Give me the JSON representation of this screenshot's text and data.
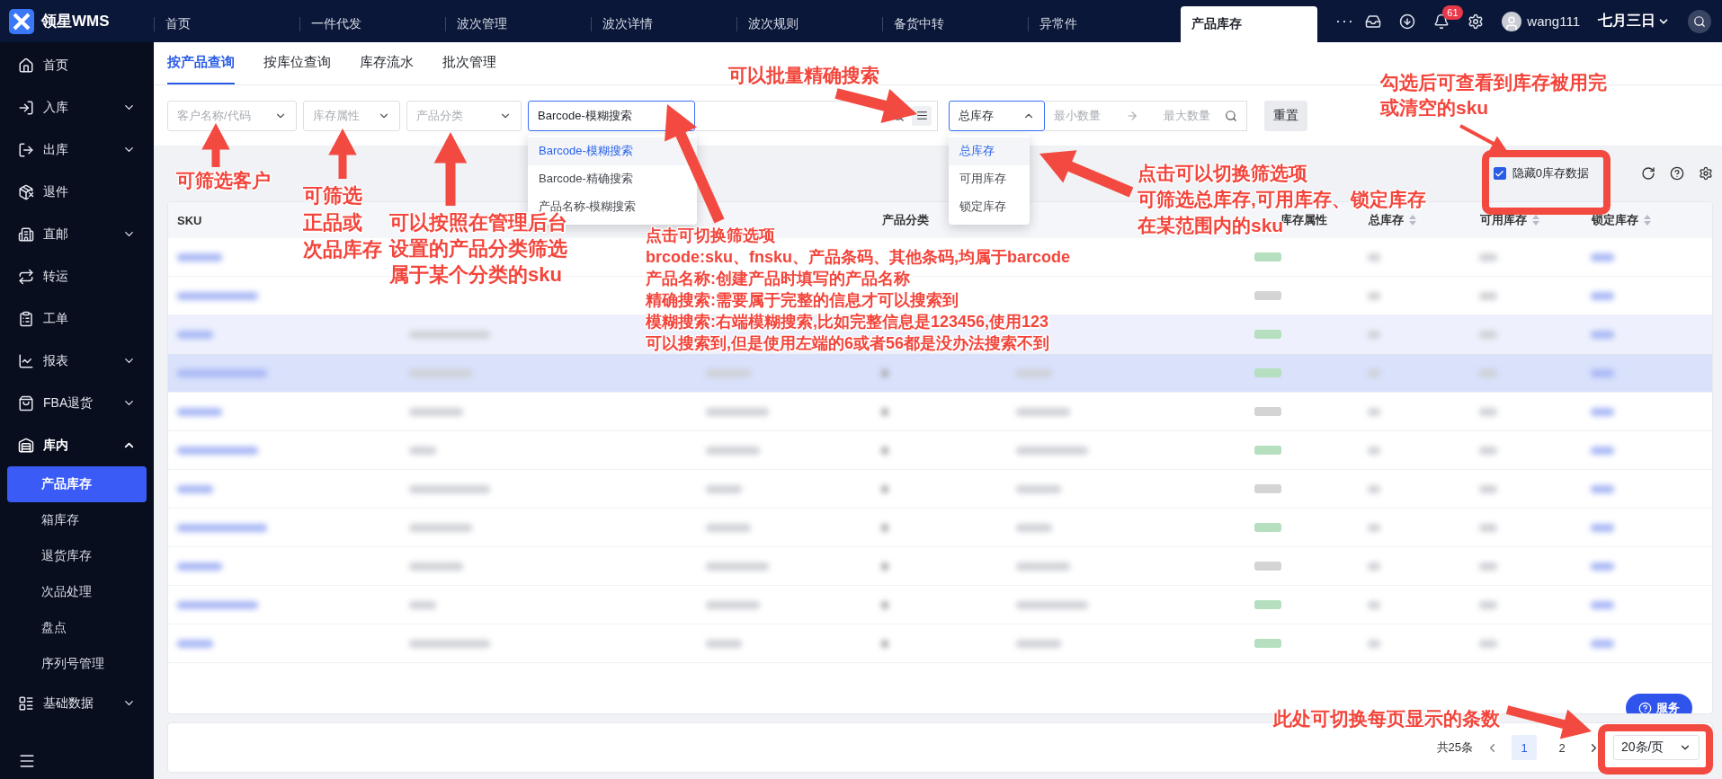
{
  "logo": {
    "text": "领星WMS"
  },
  "top_tabs": [
    {
      "label": "首页",
      "selected": false
    },
    {
      "label": "一件代发",
      "selected": false
    },
    {
      "label": "波次管理",
      "selected": false
    },
    {
      "label": "波次详情",
      "selected": false
    },
    {
      "label": "波次规则",
      "selected": false
    },
    {
      "label": "备货中转",
      "selected": false
    },
    {
      "label": "异常件",
      "selected": false
    },
    {
      "label": "产品库存",
      "selected": true
    }
  ],
  "top_more": "···",
  "notifications": {
    "badge": "61"
  },
  "user": {
    "name": "wang111"
  },
  "date_menu": {
    "label": "七月三日"
  },
  "sidebar": {
    "items": [
      {
        "label": "首页",
        "kind": "link",
        "expanded": false
      },
      {
        "label": "入库",
        "kind": "group",
        "expanded": false
      },
      {
        "label": "出库",
        "kind": "group",
        "expanded": false
      },
      {
        "label": "退件",
        "kind": "link",
        "expanded": false
      },
      {
        "label": "直邮",
        "kind": "group",
        "expanded": false
      },
      {
        "label": "转运",
        "kind": "link",
        "expanded": false
      },
      {
        "label": "工单",
        "kind": "link",
        "expanded": false
      },
      {
        "label": "报表",
        "kind": "group",
        "expanded": false
      },
      {
        "label": "FBA退货",
        "kind": "group",
        "expanded": false
      },
      {
        "label": "库内",
        "kind": "group",
        "expanded": true,
        "children": [
          {
            "label": "产品库存",
            "selected": true
          },
          {
            "label": "箱库存",
            "selected": false
          },
          {
            "label": "退货库存",
            "selected": false
          },
          {
            "label": "次品处理",
            "selected": false
          },
          {
            "label": "盘点",
            "selected": false
          },
          {
            "label": "序列号管理",
            "selected": false
          }
        ]
      },
      {
        "label": "基础数据",
        "kind": "group",
        "expanded": false
      }
    ]
  },
  "page_tabs": [
    {
      "label": "按产品查询",
      "selected": true
    },
    {
      "label": "按库位查询",
      "selected": false
    },
    {
      "label": "库存流水",
      "selected": false
    },
    {
      "label": "批次管理",
      "selected": false
    }
  ],
  "filters": {
    "customer": {
      "placeholder": "客户名称/代码"
    },
    "stock_attribute": {
      "placeholder": "库存属性"
    },
    "category": {
      "placeholder": "产品分类"
    },
    "search_mode": {
      "value": "Barcode-模糊搜索",
      "options": [
        {
          "label": "Barcode-模糊搜索",
          "selected": true
        },
        {
          "label": "Barcode-精确搜索",
          "selected": false
        },
        {
          "label": "产品名称-模糊搜索",
          "selected": false
        }
      ]
    },
    "stock_type": {
      "value": "总库存",
      "options": [
        {
          "label": "总库存",
          "selected": true
        },
        {
          "label": "可用库存",
          "selected": false
        },
        {
          "label": "锁定库存",
          "selected": false
        }
      ]
    },
    "min_qty": {
      "placeholder": "最小数量"
    },
    "max_qty": {
      "placeholder": "最大数量"
    },
    "reset": "重置"
  },
  "hide_zero": {
    "label": "隐藏0库存数据",
    "checked": true
  },
  "table": {
    "columns": [
      {
        "label": "SKU",
        "sortable": false
      },
      {},
      {},
      {
        "label": "产品分类",
        "sortable": false
      },
      {},
      {
        "label": "库存属性",
        "sortable": false
      },
      {
        "label": "总库存",
        "sortable": true
      },
      {
        "label": "可用库存",
        "sortable": true
      },
      {
        "label": "锁定库存",
        "sortable": true
      }
    ],
    "rows": [
      {
        "selected": false,
        "hovered": false,
        "color": "#b5dfbf"
      },
      {
        "selected": false,
        "hovered": false,
        "color": "#d4d4d4"
      },
      {
        "selected": false,
        "hovered": true,
        "color": "#b5dfbf"
      },
      {
        "selected": true,
        "hovered": false,
        "color": "#b5dfbf"
      },
      {
        "selected": false,
        "hovered": false,
        "color": "#d4d4d4"
      },
      {
        "selected": false,
        "hovered": false,
        "color": "#b5dfbf"
      },
      {
        "selected": false,
        "hovered": false,
        "color": "#d4d4d4"
      },
      {
        "selected": false,
        "hovered": false,
        "color": "#b5dfbf"
      },
      {
        "selected": false,
        "hovered": false,
        "color": "#d4d4d4"
      },
      {
        "selected": false,
        "hovered": false,
        "color": "#b5dfbf"
      },
      {
        "selected": false,
        "hovered": false,
        "color": "#b5dfbf"
      }
    ]
  },
  "service_button": "服务",
  "pagination": {
    "total": "共25条",
    "pages": [
      {
        "label": "1",
        "selected": true
      },
      {
        "label": "2",
        "selected": false
      }
    ],
    "page_size": "20条/页"
  },
  "annotations": [
    {
      "lines": [
        "可以批量精确搜索"
      ]
    },
    {
      "lines": [
        "勾选后可查看到库存被用完",
        "或清空的sku"
      ]
    },
    {
      "lines": [
        "可筛选客户"
      ]
    },
    {
      "lines": [
        "可筛选",
        "正品或",
        "次品库存"
      ]
    },
    {
      "lines": [
        "可以按照在管理后台",
        "设置的产品分类筛选",
        "属于某个分类的sku"
      ]
    },
    {
      "lines": [
        "点击可切换筛选项",
        "brcode:sku、fnsku、产品条码、其他条码,均属于barcode",
        "产品名称:创建产品时填写的产品名称",
        "精确搜索:需要属于完整的信息才可以搜索到",
        "模糊搜索:右端模糊搜索,比如完整信息是123456,使用123",
        "可以搜索到,但是使用左端的6或者56都是没办法搜索不到"
      ]
    },
    {
      "lines": [
        "点击可以切换筛选项",
        "可筛选总库存,可用库存、锁定库存",
        "在某范围内的sku"
      ]
    },
    {
      "lines": [
        "此处可切换每页显示的条数"
      ]
    }
  ]
}
